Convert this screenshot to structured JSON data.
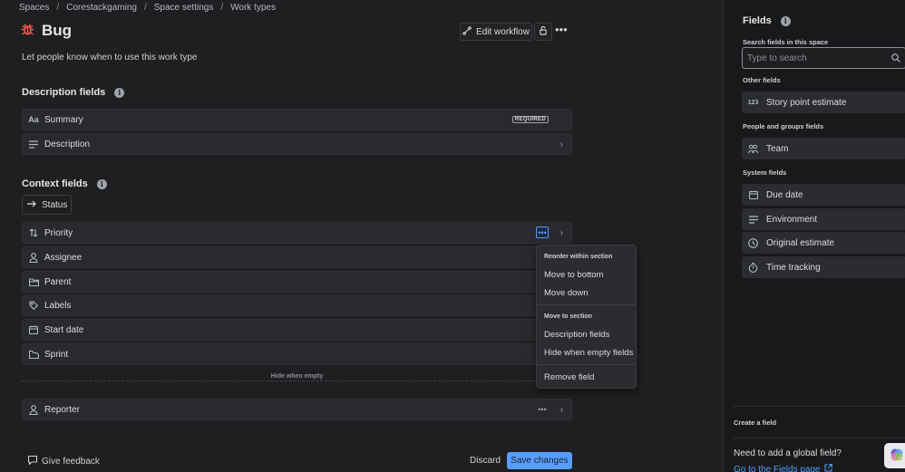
{
  "breadcrumbs": [
    "Spaces",
    "Corestackgaming",
    "Space settings",
    "Work types"
  ],
  "breadcrumb_separator": "/",
  "work_type": {
    "name": "Bug",
    "description": "Let people know when to use this work type",
    "icon": "bug-icon",
    "icon_color": "#f15b50"
  },
  "header_actions": {
    "edit_workflow": "Edit workflow",
    "lock_icon": "unlock-icon",
    "more_icon": "more-icon"
  },
  "description_section": {
    "title": "Description fields",
    "fields": [
      {
        "label": "Summary",
        "icon": "text-icon",
        "badge": "REQUIRED"
      },
      {
        "label": "Description",
        "icon": "lines-icon"
      }
    ]
  },
  "context_section": {
    "title": "Context fields",
    "status_label": "Status",
    "fields": [
      {
        "label": "Priority",
        "icon": "sort-icon"
      },
      {
        "label": "Assignee",
        "icon": "person-icon"
      },
      {
        "label": "Parent",
        "icon": "folder-icon"
      },
      {
        "label": "Labels",
        "icon": "tag-icon"
      },
      {
        "label": "Start date",
        "icon": "calendar-icon"
      },
      {
        "label": "Sprint",
        "icon": "sprint-icon"
      }
    ],
    "hide_when_empty_label": "Hide when empty",
    "hidden_fields": [
      {
        "label": "Reporter",
        "icon": "person-icon"
      }
    ]
  },
  "context_menu": {
    "reorder_header": "Reorder within section",
    "reorder_items": [
      "Move to bottom",
      "Move down"
    ],
    "move_header": "Move to section",
    "move_items": [
      "Description fields",
      "Hide when empty fields"
    ],
    "remove_item": "Remove field"
  },
  "footer": {
    "feedback": "Give feedback",
    "discard": "Discard",
    "save": "Save changes"
  },
  "sidebar": {
    "title": "Fields",
    "search_label": "Search fields in this space",
    "search_placeholder": "Type to search",
    "groups": [
      {
        "label": "Other fields",
        "items": [
          {
            "label": "Story point estimate",
            "icon": "number-icon",
            "icon_text": "123"
          }
        ]
      },
      {
        "label": "People and groups fields",
        "items": [
          {
            "label": "Team",
            "icon": "team-icon"
          }
        ]
      },
      {
        "label": "System fields",
        "items": [
          {
            "label": "Due date",
            "icon": "calendar-icon"
          },
          {
            "label": "Environment",
            "icon": "lines-icon"
          },
          {
            "label": "Original estimate",
            "icon": "clock-icon"
          },
          {
            "label": "Time tracking",
            "icon": "stopwatch-icon"
          }
        ]
      }
    ],
    "create_field_label": "Create a field",
    "global_prompt": "Need to add a global field?",
    "fields_page_link": "Go to the Fields page"
  },
  "colors": {
    "accent": "#579dff",
    "background": "#1f1f21",
    "sidebar_bg": "#18191a",
    "row_bg": "#292a2d"
  }
}
